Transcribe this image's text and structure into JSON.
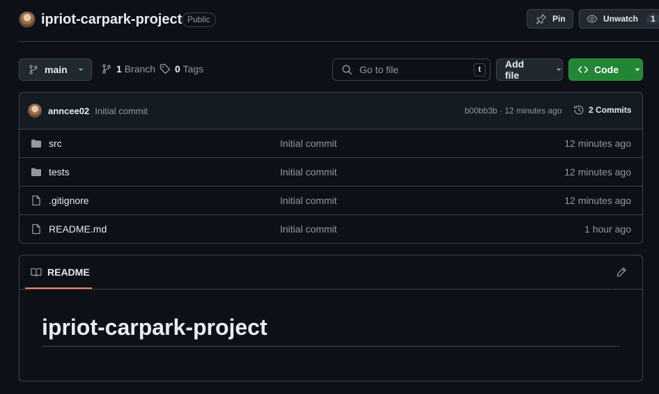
{
  "repo": {
    "name": "ipriot-carpark-project",
    "visibility": "Public",
    "pin_label": "Pin",
    "watch_label": "Unwatch",
    "watch_count": "1"
  },
  "toolbar": {
    "branch_name": "main",
    "branch_count": "1",
    "branch_label": "Branch",
    "tag_count": "0",
    "tag_label": "Tags",
    "goto_placeholder": "Go to file",
    "goto_shortcut": "t",
    "add_file_label": "Add file",
    "code_label": "Code"
  },
  "latest_commit": {
    "author": "anncee02",
    "message": "Initial commit",
    "meta": "b00bb3b · 12 minutes ago",
    "commits_count": "2",
    "commits_label": "Commits"
  },
  "files": [
    {
      "type": "folder",
      "name": "src",
      "commit": "Initial commit",
      "time": "12 minutes ago"
    },
    {
      "type": "folder",
      "name": "tests",
      "commit": "Initial commit",
      "time": "12 minutes ago"
    },
    {
      "type": "file",
      "name": ".gitignore",
      "commit": "Initial commit",
      "time": "12 minutes ago"
    },
    {
      "type": "file",
      "name": "README.md",
      "commit": "Initial commit",
      "time": "1 hour ago"
    }
  ],
  "readme": {
    "tab_label": "README",
    "heading": "ipriot-carpark-project"
  },
  "colors": {
    "background": "#0d1117",
    "border": "#3d444d",
    "code_button": "#238636",
    "tab_underline": "#f78166"
  }
}
